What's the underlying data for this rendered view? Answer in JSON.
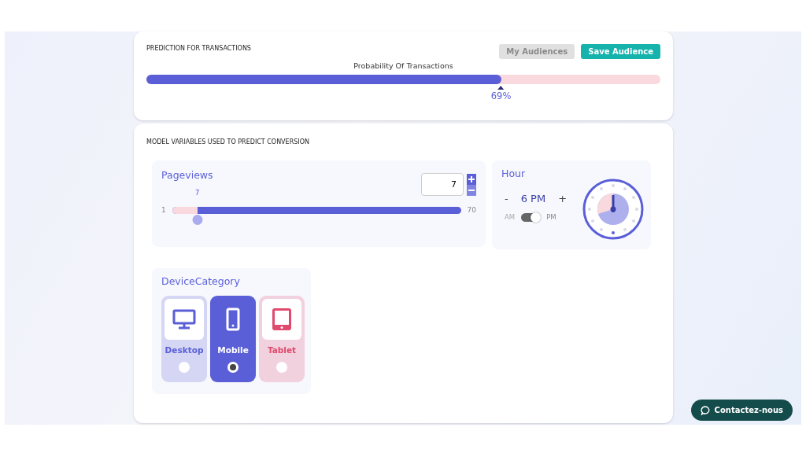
{
  "prediction": {
    "title": "PREDICTION FOR TRANSACTIONS",
    "buttons": [
      {
        "label": "My Audiences",
        "disabled": true
      },
      {
        "label": "Save Audience",
        "disabled": false
      }
    ],
    "probability": {
      "label": "Probability Of Transactions",
      "level": 0.69,
      "reading": "69%"
    }
  },
  "model": {
    "title": "MODEL VARIABLES USED TO PREDICT CONVERSION",
    "pageviews": {
      "title": "Pageviews",
      "value": "7",
      "min": "1",
      "max": "70",
      "marker": "7",
      "level": 0.087
    },
    "hour": {
      "title": "Hour",
      "minus": "-",
      "value": "6 PM",
      "plus": "+",
      "am": "AM",
      "pm": "PM",
      "pm_on": true
    },
    "device": {
      "title": "DeviceCategory",
      "options": [
        {
          "kind": "desktop",
          "label": "Desktop",
          "selected": false,
          "color": "#5a5fd8"
        },
        {
          "kind": "mobile",
          "label": "Mobile",
          "selected": true,
          "color": "#5a5fd8"
        },
        {
          "kind": "tablet",
          "label": "Tablet",
          "selected": false,
          "color": "#e04a6e"
        }
      ]
    }
  },
  "chat": {
    "label": "Contactez-nous"
  }
}
